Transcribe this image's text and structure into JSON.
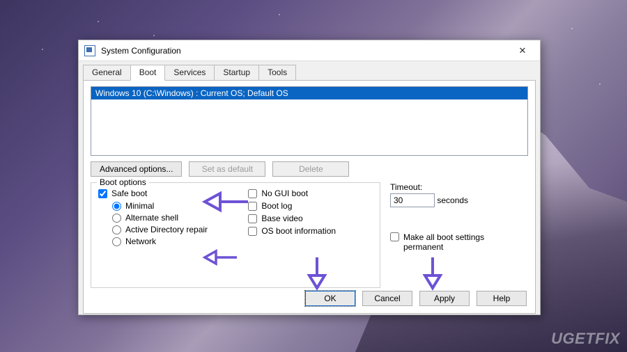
{
  "watermark": "UGETFIX",
  "window": {
    "title": "System Configuration"
  },
  "tabs": {
    "items": [
      {
        "label": "General"
      },
      {
        "label": "Boot"
      },
      {
        "label": "Services"
      },
      {
        "label": "Startup"
      },
      {
        "label": "Tools"
      }
    ],
    "active_index": 1
  },
  "os_list": {
    "selected": "Windows 10 (C:\\Windows) : Current OS; Default OS"
  },
  "os_buttons": {
    "advanced": "Advanced options...",
    "set_default": "Set as default",
    "delete": "Delete"
  },
  "boot_options": {
    "legend": "Boot options",
    "safe_boot": {
      "label": "Safe boot",
      "checked": true
    },
    "safe_modes": {
      "minimal": "Minimal",
      "alt_shell": "Alternate shell",
      "ad_repair": "Active Directory repair",
      "network": "Network",
      "selected": "minimal"
    },
    "no_gui": {
      "label": "No GUI boot",
      "checked": false
    },
    "boot_log": {
      "label": "Boot log",
      "checked": false
    },
    "base_video": {
      "label": "Base video",
      "checked": false
    },
    "os_info": {
      "label": "OS boot information",
      "checked": false
    }
  },
  "timeout": {
    "label": "Timeout:",
    "value": "30",
    "unit": "seconds"
  },
  "permanent": {
    "label": "Make all boot settings permanent",
    "checked": false
  },
  "dialog_buttons": {
    "ok": "OK",
    "cancel": "Cancel",
    "apply": "Apply",
    "help": "Help"
  },
  "annotations": {
    "arrow_color": "#6d52d6",
    "arrows": [
      "safe-boot-left",
      "network-left",
      "ok-down",
      "apply-down"
    ]
  }
}
